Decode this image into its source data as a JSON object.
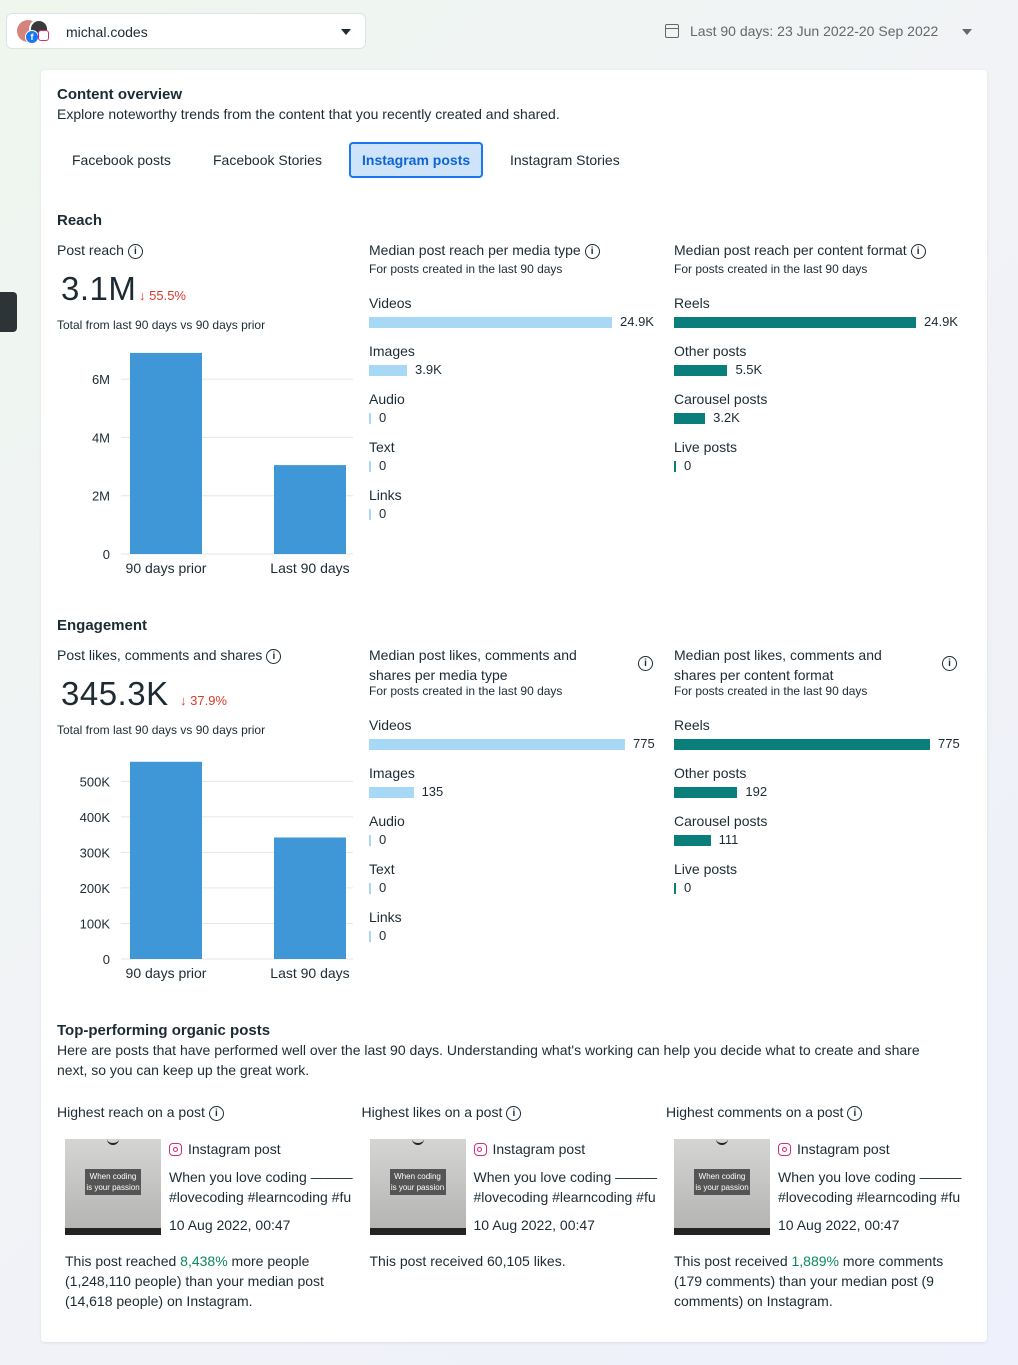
{
  "account": {
    "name": "michal.codes"
  },
  "date_range": {
    "label": "Last 90 days: 23 Jun 2022-20 Sep 2022"
  },
  "overview": {
    "title": "Content overview",
    "subtitle": "Explore noteworthy trends from the content that you recently created and shared."
  },
  "tabs": [
    "Facebook posts",
    "Facebook Stories",
    "Instagram posts",
    "Instagram Stories"
  ],
  "active_tab": "Instagram posts",
  "colors": {
    "accent": "#1877f2",
    "media_bar": "#a7d9f7",
    "format_bar": "#0a7e7a",
    "column": "#3f97d7",
    "negative": "#d93a29",
    "positive": "#0a8a5a"
  },
  "reach": {
    "title": "Reach",
    "metric_label": "Post reach",
    "value": "3.1M",
    "delta": "55.5%",
    "note": "Total from last 90 days vs 90 days prior",
    "media": {
      "title": "Median post reach per media type",
      "note": "For posts created in the last 90 days",
      "items": [
        {
          "label": "Videos",
          "display": "24.9K",
          "value": 24900
        },
        {
          "label": "Images",
          "display": "3.9K",
          "value": 3900
        },
        {
          "label": "Audio",
          "display": "0",
          "value": 0
        },
        {
          "label": "Text",
          "display": "0",
          "value": 0
        },
        {
          "label": "Links",
          "display": "0",
          "value": 0
        }
      ]
    },
    "format": {
      "title": "Median post reach per content format",
      "note": "For posts created in the last 90 days",
      "items": [
        {
          "label": "Reels",
          "display": "24.9K",
          "value": 24900
        },
        {
          "label": "Other posts",
          "display": "5.5K",
          "value": 5500
        },
        {
          "label": "Carousel posts",
          "display": "3.2K",
          "value": 3200
        },
        {
          "label": "Live posts",
          "display": "0",
          "value": 0
        }
      ]
    }
  },
  "engagement": {
    "title": "Engagement",
    "metric_label": "Post likes, comments and shares",
    "value": "345.3K",
    "delta": "37.9%",
    "note": "Total from last 90 days vs 90 days prior",
    "media": {
      "title_line1": "Median post likes, comments and",
      "title_line2": "shares per media type",
      "note": "For posts created in the last 90 days",
      "items": [
        {
          "label": "Videos",
          "display": "775",
          "value": 775
        },
        {
          "label": "Images",
          "display": "135",
          "value": 135
        },
        {
          "label": "Audio",
          "display": "0",
          "value": 0
        },
        {
          "label": "Text",
          "display": "0",
          "value": 0
        },
        {
          "label": "Links",
          "display": "0",
          "value": 0
        }
      ]
    },
    "format": {
      "title_line1": "Median post likes, comments and",
      "title_line2": "shares per content format",
      "note": "For posts created in the last 90 days",
      "items": [
        {
          "label": "Reels",
          "display": "775",
          "value": 775
        },
        {
          "label": "Other posts",
          "display": "192",
          "value": 192
        },
        {
          "label": "Carousel posts",
          "display": "111",
          "value": 111
        },
        {
          "label": "Live posts",
          "display": "0",
          "value": 0
        }
      ]
    }
  },
  "chart_data": [
    {
      "type": "bar",
      "categories": [
        "90 days prior",
        "Last 90 days"
      ],
      "values": [
        6900000,
        3050000
      ],
      "ylim": [
        0,
        7000000
      ],
      "yticks": [
        0,
        2000000,
        4000000,
        6000000
      ],
      "ytick_labels": [
        "0",
        "2M",
        "4M",
        "6M"
      ],
      "grid": true
    },
    {
      "type": "bar",
      "categories": [
        "90 days prior",
        "Last 90 days"
      ],
      "values": [
        555000,
        342000
      ],
      "ylim": [
        0,
        560000
      ],
      "yticks": [
        0,
        100000,
        200000,
        300000,
        400000,
        500000
      ],
      "ytick_labels": [
        "0",
        "100K",
        "200K",
        "300K",
        "400K",
        "500K"
      ],
      "grid": true
    }
  ],
  "top_posts": {
    "title": "Top-performing organic posts",
    "desc_line1": "Here are posts that have performed well over the last 90 days. Understanding what's working can help you decide what to create and share",
    "desc_line2": "next, so you can keep up the great work.",
    "thumb_text_1": "When coding",
    "thumb_text_2": "is your passion",
    "cards": [
      {
        "heading": "Highest reach on a post",
        "platform": "Instagram post",
        "caption1": "When you love coding ———",
        "caption2": "#lovecoding #learncoding #fu",
        "date": "10 Aug 2022, 00:47",
        "s1": "This post reached ",
        "hl": "8,438%",
        "s2": " more people",
        "line2": "(1,248,110 people) than your median post",
        "line3": "(14,618 people) on Instagram."
      },
      {
        "heading": "Highest likes on a post",
        "platform": "Instagram post",
        "caption1": "When you love coding ———",
        "caption2": "#lovecoding #learncoding #fu",
        "date": "10 Aug 2022, 00:47",
        "s1": "This post received 60,105 likes.",
        "hl": "",
        "s2": "",
        "line2": "",
        "line3": ""
      },
      {
        "heading": "Highest comments on a post",
        "platform": "Instagram post",
        "caption1": "When you love coding ———",
        "caption2": "#lovecoding #learncoding #fu",
        "date": "10 Aug 2022, 00:47",
        "s1": "This post received ",
        "hl": "1,889%",
        "s2": " more comments",
        "line2": "(179 comments) than your median post (9",
        "line3": "comments) on Instagram."
      }
    ]
  }
}
